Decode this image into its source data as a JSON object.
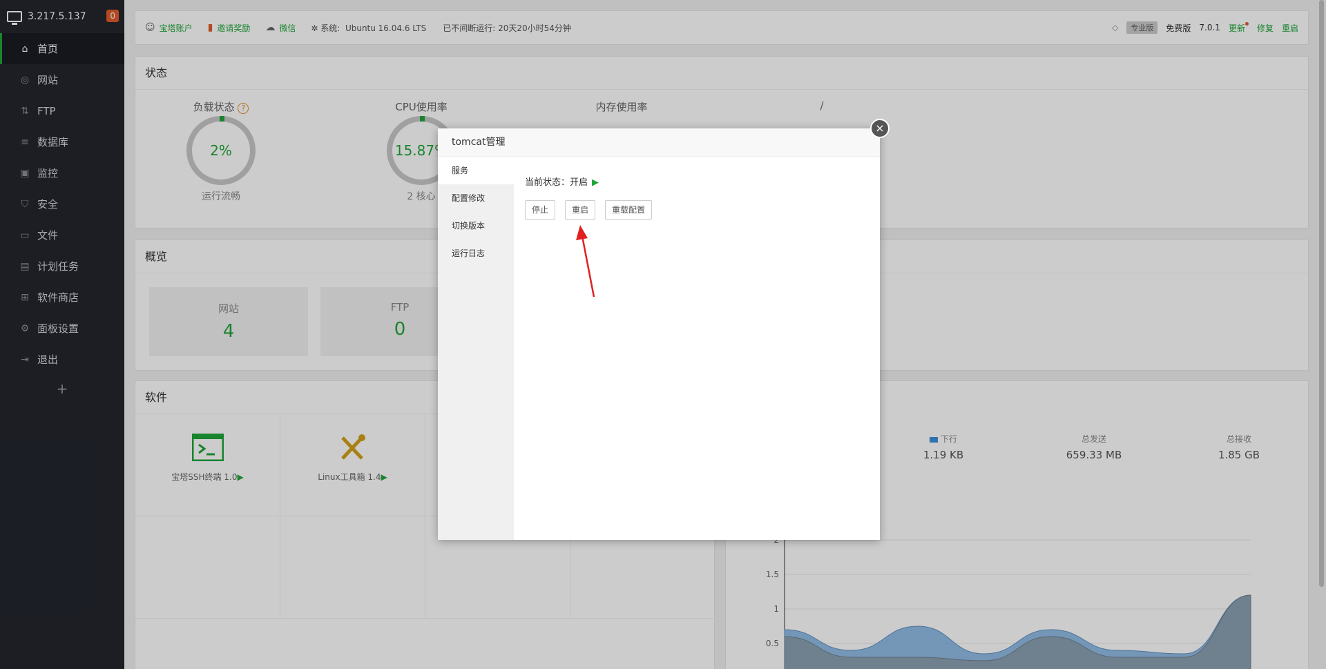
{
  "sidebar": {
    "host": "3.217.5.137",
    "badge": "0",
    "items": [
      {
        "label": "首页",
        "icon": "home-icon"
      },
      {
        "label": "网站",
        "icon": "globe-icon"
      },
      {
        "label": "FTP",
        "icon": "ftp-icon"
      },
      {
        "label": "数据库",
        "icon": "database-icon"
      },
      {
        "label": "监控",
        "icon": "monitor-icon"
      },
      {
        "label": "安全",
        "icon": "shield-icon"
      },
      {
        "label": "文件",
        "icon": "folder-icon"
      },
      {
        "label": "计划任务",
        "icon": "calendar-icon"
      },
      {
        "label": "软件商店",
        "icon": "grid-icon"
      },
      {
        "label": "面板设置",
        "icon": "gear-icon"
      },
      {
        "label": "退出",
        "icon": "logout-icon"
      }
    ],
    "add": "+"
  },
  "topbar": {
    "account": "宝塔账户",
    "invite": "邀请奖励",
    "wechat": "微信",
    "system_label": "系统:",
    "system_value": "Ubuntu 16.04.6 LTS",
    "uptime": "已不间断运行: 20天20小时54分钟",
    "pro": "专业版",
    "free": "免费版",
    "version": "7.0.1",
    "update": "更新",
    "repair": "修复",
    "restart": "重启"
  },
  "status": {
    "title": "状态",
    "load_label": "负载状态",
    "load_value": "2%",
    "load_sub": "运行流畅",
    "cpu_label": "CPU使用率",
    "cpu_value": "15.87%",
    "cpu_sub": "2 核心",
    "mem_label": "内存使用率",
    "disk_label": "/"
  },
  "overview": {
    "title": "概览",
    "site_label": "网站",
    "site_value": "4",
    "ftp_label": "FTP",
    "ftp_value": "0"
  },
  "software": {
    "title": "软件",
    "items": [
      {
        "name": "宝塔SSH终端 1.0",
        "icon": "terminal-icon"
      },
      {
        "name": "Linux工具箱 1.4",
        "icon": "tools-icon"
      }
    ]
  },
  "traffic": {
    "down_label": "下行",
    "down_value": "1.19 KB",
    "sent_label": "总发送",
    "sent_value": "659.33 MB",
    "recv_label": "总接收",
    "recv_value": "1.85 GB"
  },
  "chart_data": {
    "type": "area",
    "yticks": [
      "2",
      "1.5",
      "1",
      "0.5"
    ],
    "ylim": [
      0,
      2.5
    ],
    "series": [
      {
        "name": "下行",
        "values": [
          0.7,
          0.4,
          0.75,
          0.35,
          0.7,
          0.4,
          0.35,
          1.2
        ]
      },
      {
        "values": [
          0.6,
          0.3,
          0.3,
          0.25,
          0.6,
          0.3,
          0.3,
          1.2
        ]
      }
    ],
    "colors": {
      "down": "#7fb0e0",
      "up": "#8a9aa6"
    }
  },
  "modal": {
    "title": "tomcat管理",
    "close": "×",
    "nav": [
      "服务",
      "配置修改",
      "切换版本",
      "运行日志"
    ],
    "state_label": "当前状态：开启",
    "buttons": {
      "stop": "停止",
      "restart": "重启",
      "reload": "重载配置"
    }
  },
  "colors": {
    "accent": "#20a53a",
    "sidebar": "#23262e",
    "annotation": "#e02020"
  }
}
